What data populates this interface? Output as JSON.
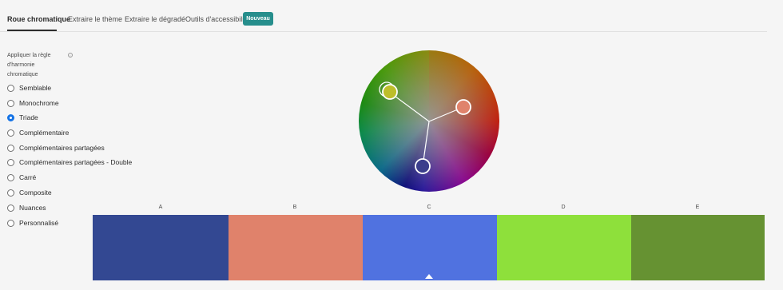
{
  "tabs": [
    {
      "label": "Roue chromatique",
      "active": true
    },
    {
      "label": "Extraire le thème",
      "active": false
    },
    {
      "label": "Extraire le dégradé",
      "active": false
    },
    {
      "label": "Outils d'accessibilité",
      "active": false
    }
  ],
  "badge": "Nouveau",
  "harmony": {
    "label": "Appliquer la règle d'harmonie chromatique",
    "info_icon": "info-icon",
    "selected": "Triade",
    "options": [
      "Semblable",
      "Monochrome",
      "Triade",
      "Complémentaire",
      "Complémentaires partagées",
      "Complémentaires partagées - Double",
      "Carré",
      "Composite",
      "Nuances",
      "Personnalisé"
    ]
  },
  "wheel": {
    "handle_colors": [
      "#bdbe2a",
      "#e0836c",
      "#3b3e8c"
    ]
  },
  "swatches": [
    {
      "label": "A",
      "color": "#334892"
    },
    {
      "label": "B",
      "color": "#e0826b"
    },
    {
      "label": "C",
      "color": "#5072e0"
    },
    {
      "label": "D",
      "color": "#8ee03b"
    },
    {
      "label": "E",
      "color": "#669232"
    }
  ],
  "selected_swatch": "C"
}
